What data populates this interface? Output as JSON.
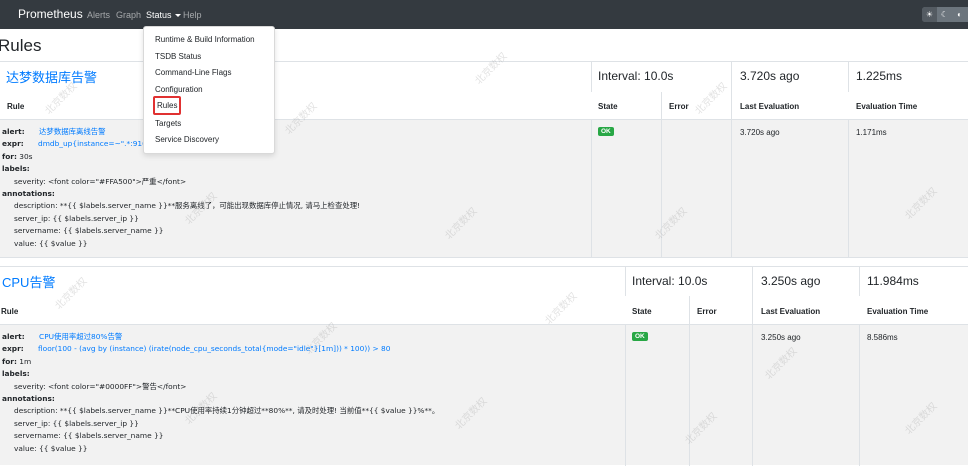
{
  "navbar": {
    "brand": "Prometheus",
    "links": [
      "Alerts",
      "Graph",
      "Status",
      "Help"
    ],
    "theme_icons": [
      "sun-icon",
      "moon-icon",
      "contrast-icon"
    ]
  },
  "status_menu": {
    "items": [
      "Runtime & Build Information",
      "TSDB Status",
      "Command-Line Flags",
      "Configuration",
      "Rules",
      "Targets",
      "Service Discovery"
    ]
  },
  "page": {
    "title": "Rules"
  },
  "groups": [
    {
      "name": "达梦数据库告警",
      "interval": "Interval: 10.0s",
      "last_eval": "3.720s ago",
      "eval_time": "1.225ms",
      "headers": {
        "rule": "Rule",
        "state": "State",
        "error": "Error",
        "last": "Last Evaluation",
        "time": "Evaluation Time"
      },
      "rule": {
        "alert_key": "alert:",
        "alert": "达梦数据库离线告警",
        "expr_key": "expr:",
        "expr": "dmdb_up{instance=~\".*:9161\"",
        "for_key": "for:",
        "for": "30s",
        "labels_key": "labels:",
        "severity": "severity: <font color=\"#FFA500\">严重</font>",
        "annotations_key": "annotations:",
        "description": "description: **{{ $labels.server_name }}**服务离线了，可能出现数据库停止情况, 请马上检查处理!",
        "server_ip": "server_ip: {{ $labels.server_ip }}",
        "servername": "servername: {{ $labels.server_name }}",
        "value": "value: {{ $value }}",
        "state": "OK",
        "error": "",
        "last": "3.720s ago",
        "time": "1.171ms"
      }
    },
    {
      "name": "CPU告警",
      "interval": "Interval: 10.0s",
      "last_eval": "3.250s ago",
      "eval_time": "11.984ms",
      "headers": {
        "rule": "Rule",
        "state": "State",
        "error": "Error",
        "last": "Last Evaluation",
        "time": "Evaluation Time"
      },
      "rule": {
        "alert_key": "alert:",
        "alert": "CPU使用率超过80%告警",
        "expr_key": "expr:",
        "expr": "floor(100 - (avg by (instance) (irate(node_cpu_seconds_total{mode=\"idle\"}[1m])) * 100)) > 80",
        "for_key": "for:",
        "for": "1m",
        "labels_key": "labels:",
        "severity": "severity: <font color=\"#0000FF\">警告</font>",
        "annotations_key": "annotations:",
        "description": "description: **{{ $labels.server_name }}**CPU使用率持续1分钟超过**80%**, 请及时处理! 当前值**{{ $value }}%**。",
        "server_ip": "server_ip: {{ $labels.server_ip }}",
        "servername": "servername: {{ $labels.server_name }}",
        "value": "value: {{ $value }}",
        "state": "OK",
        "error": "",
        "last": "3.250s ago",
        "time": "8.586ms"
      }
    }
  ],
  "watermark": "北京数权"
}
